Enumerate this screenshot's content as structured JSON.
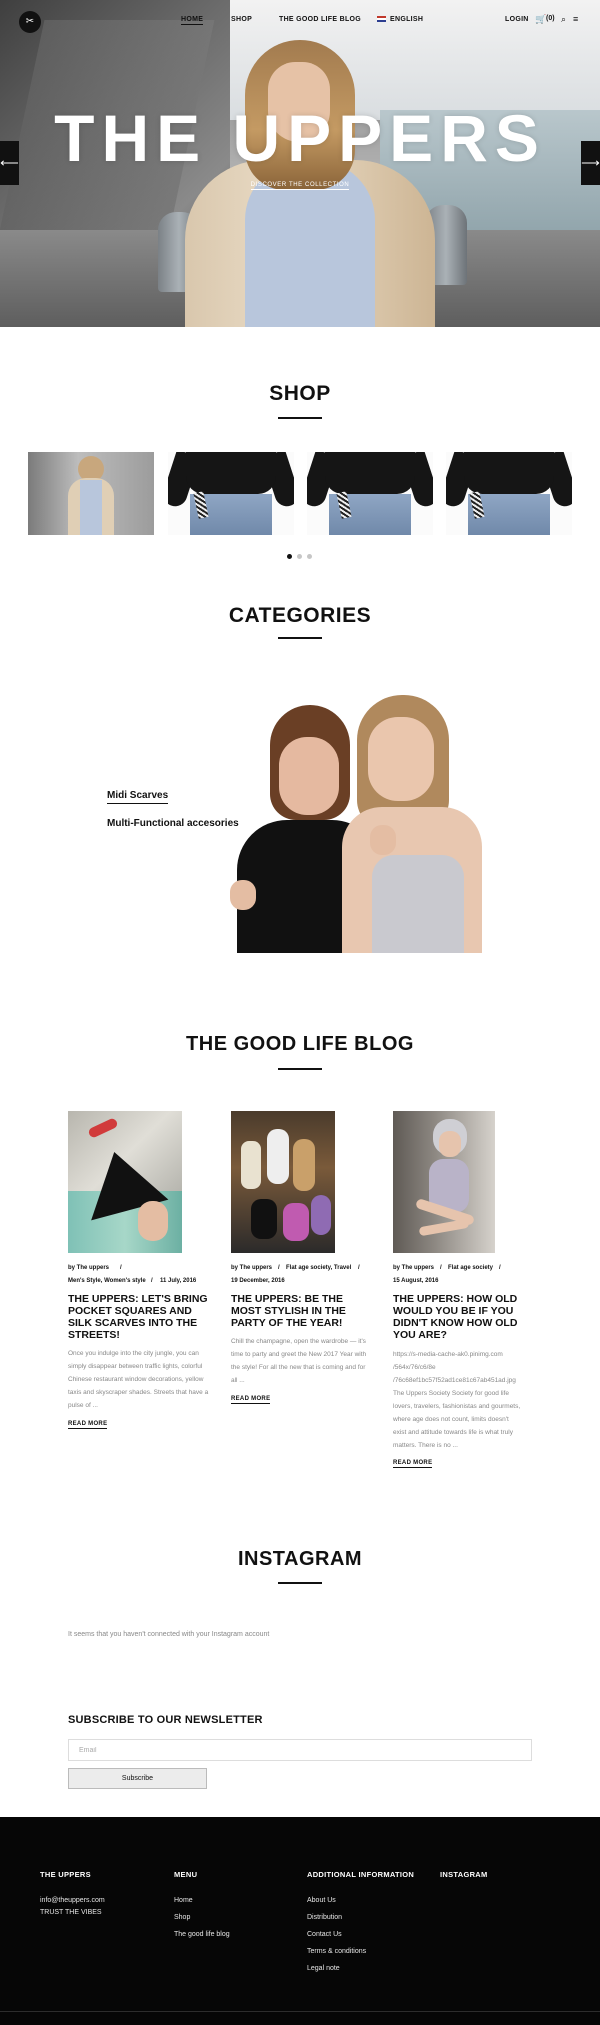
{
  "colors": {
    "text": "#111111",
    "muted": "#888888",
    "footer_bg": "#060606",
    "white": "#ffffff"
  },
  "nav": {
    "logo_icon": "scissors-logo-icon",
    "items": [
      {
        "label": "HOME"
      },
      {
        "label": "SHOP"
      },
      {
        "label": "THE GOOD LIFE BLOG"
      },
      {
        "label": "ENGLISH"
      }
    ],
    "login_label": "LOGIN",
    "cart_count": "(0)",
    "cart_icon": "cart-icon",
    "search_icon": "search-icon",
    "menu_icon": "hamburger-menu-icon"
  },
  "hero": {
    "title": "THE UPPERS",
    "subtitle": "DISCOVER THE COLLECTION",
    "prev_icon": "arrow-left-icon",
    "next_icon": "arrow-right-icon"
  },
  "shop": {
    "title": "SHOP",
    "active_slide": 1,
    "slide_count": 3
  },
  "categories": {
    "title": "CATEGORIES",
    "items": [
      {
        "label": "Midi Scarves"
      },
      {
        "label": "Multi-Functional accesories"
      }
    ]
  },
  "blog": {
    "title": "THE GOOD LIFE BLOG",
    "posts": [
      {
        "author": "by The uppers",
        "categories": "Men's Style, Women's style",
        "date": "11 July, 2016",
        "title": "THE UPPERS: LET'S BRING POCKET SQUARES AND SILK SCARVES INTO THE STREETS!",
        "excerpt": "Once you indulge into the city jungle, you can simply disappear between traffic lights, colorful Chinese restaurant window decorations, yellow taxis and skyscraper shades. Streets that have a pulse of ...",
        "read_more": "READ MORE"
      },
      {
        "author": "by The uppers",
        "categories": "Flat age society, Travel",
        "date": "19 December, 2016",
        "title": "THE UPPERS: BE THE MOST STYLISH IN THE PARTY OF THE YEAR!",
        "excerpt": "Chill the champagne, open the wardrobe — it's time to party and greet the New 2017 Year with the style! For all the new that is coming and for all ...",
        "read_more": "READ MORE"
      },
      {
        "author": "by The uppers",
        "categories": "Flat age society",
        "date": "15 August, 2016",
        "title": "THE UPPERS: HOW OLD WOULD YOU BE IF YOU DIDN'T KNOW HOW OLD YOU ARE?",
        "excerpt_lines": [
          "https://s-media-cache-ak0.pinimg.com",
          "/564x/76/c6/8e",
          "/76c68ef1bc57f52ad1ce81c67ab451ad.jpg",
          "The Uppers Society Society for good life",
          "lovers, travelers, fashionistas and gourmets,",
          "where age does not count, limits doesn't",
          "exist and attitude towards life is what truly",
          "matters. There is no ..."
        ],
        "read_more": "READ MORE"
      }
    ]
  },
  "instagram": {
    "title": "INSTAGRAM",
    "note": "It seems that you haven't connected with your Instagram account"
  },
  "newsletter": {
    "title": "SUBSCRIBE TO OUR NEWSLETTER",
    "email_placeholder": "Email",
    "button_label": "Subscribe"
  },
  "footer": {
    "col1_title": "THE UPPERS",
    "email": "info@theuppers.com",
    "tagline": "TRUST THE VIBES",
    "menu_title": "MENU",
    "menu": [
      "Home",
      "Shop",
      "The good life blog"
    ],
    "info_title": "ADDITIONAL INFORMATION",
    "info": [
      "About Us",
      "Distribution",
      "Contact Us",
      "Terms & conditions",
      "Legal note"
    ],
    "instagram_title": "INSTAGRAM"
  }
}
